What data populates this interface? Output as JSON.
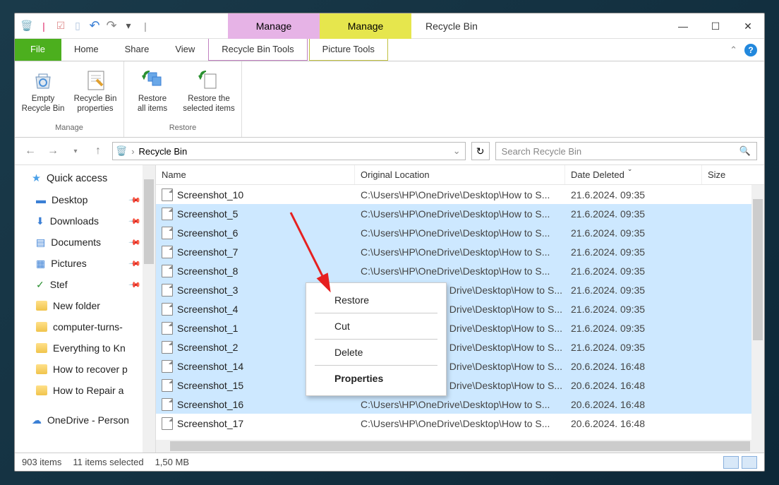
{
  "window": {
    "title": "Recycle Bin",
    "manage_tab1": "Manage",
    "manage_tab2": "Manage"
  },
  "tabs": {
    "file": "File",
    "home": "Home",
    "share": "Share",
    "view": "View",
    "recycle_tools": "Recycle Bin Tools",
    "picture_tools": "Picture Tools"
  },
  "ribbon": {
    "empty": "Empty\nRecycle Bin",
    "props": "Recycle Bin\nproperties",
    "restore_all": "Restore\nall items",
    "restore_sel": "Restore the\nselected items",
    "group_manage": "Manage",
    "group_restore": "Restore"
  },
  "address": {
    "crumb": "Recycle Bin",
    "search_placeholder": "Search Recycle Bin"
  },
  "sidebar": {
    "quick_access": "Quick access",
    "desktop": "Desktop",
    "downloads": "Downloads",
    "documents": "Documents",
    "pictures": "Pictures",
    "stef": "Stef",
    "new_folder": "New folder",
    "computer": "computer-turns-",
    "everything": "Everything to Kn",
    "recover": "How to recover p",
    "repair": "How to Repair a",
    "onedrive": "OneDrive - Person"
  },
  "columns": {
    "name": "Name",
    "location": "Original Location",
    "date": "Date Deleted",
    "size": "Size"
  },
  "files": [
    {
      "name": "Screenshot_10",
      "loc": "C:\\Users\\HP\\OneDrive\\Desktop\\How to S...",
      "date": "21.6.2024. 09:35",
      "selected": false
    },
    {
      "name": "Screenshot_5",
      "loc": "C:\\Users\\HP\\OneDrive\\Desktop\\How to S...",
      "date": "21.6.2024. 09:35",
      "selected": true
    },
    {
      "name": "Screenshot_6",
      "loc": "C:\\Users\\HP\\OneDrive\\Desktop\\How to S...",
      "date": "21.6.2024. 09:35",
      "selected": true
    },
    {
      "name": "Screenshot_7",
      "loc": "C:\\Users\\HP\\OneDrive\\Desktop\\How to S...",
      "date": "21.6.2024. 09:35",
      "selected": true
    },
    {
      "name": "Screenshot_8",
      "loc": "C:\\Users\\HP\\OneDrive\\Desktop\\How to S...",
      "date": "21.6.2024. 09:35",
      "selected": true
    },
    {
      "name": "Screenshot_3",
      "loc": "Drive\\Desktop\\How to S...",
      "date": "21.6.2024. 09:35",
      "selected": true
    },
    {
      "name": "Screenshot_4",
      "loc": "Drive\\Desktop\\How to S...",
      "date": "21.6.2024. 09:35",
      "selected": true
    },
    {
      "name": "Screenshot_1",
      "loc": "Drive\\Desktop\\How to S...",
      "date": "21.6.2024. 09:35",
      "selected": true
    },
    {
      "name": "Screenshot_2",
      "loc": "Drive\\Desktop\\How to S...",
      "date": "21.6.2024. 09:35",
      "selected": true
    },
    {
      "name": "Screenshot_14",
      "loc": "Drive\\Desktop\\How to S...",
      "date": "20.6.2024. 16:48",
      "selected": true
    },
    {
      "name": "Screenshot_15",
      "loc": "Drive\\Desktop\\How to S...",
      "date": "20.6.2024. 16:48",
      "selected": true
    },
    {
      "name": "Screenshot_16",
      "loc": "C:\\Users\\HP\\OneDrive\\Desktop\\How to S...",
      "date": "20.6.2024. 16:48",
      "selected": true
    },
    {
      "name": "Screenshot_17",
      "loc": "C:\\Users\\HP\\OneDrive\\Desktop\\How to S...",
      "date": "20.6.2024. 16:48",
      "selected": false
    }
  ],
  "context": {
    "restore": "Restore",
    "cut": "Cut",
    "delete": "Delete",
    "properties": "Properties"
  },
  "status": {
    "items": "903 items",
    "selected": "11 items selected",
    "size": "1,50 MB"
  }
}
